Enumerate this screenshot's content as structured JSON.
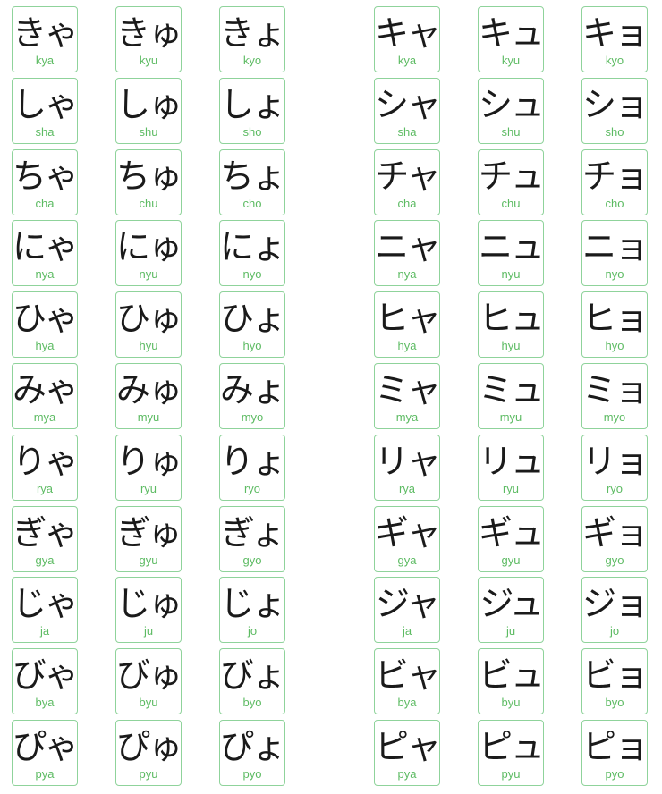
{
  "colors": {
    "border": "#8fd39b",
    "romaji": "#5dbb63",
    "kana": "#1a1a1a"
  },
  "hiragana": [
    [
      {
        "kana": "きゃ",
        "romaji": "kya"
      },
      {
        "kana": "きゅ",
        "romaji": "kyu"
      },
      {
        "kana": "きょ",
        "romaji": "kyo"
      }
    ],
    [
      {
        "kana": "しゃ",
        "romaji": "sha"
      },
      {
        "kana": "しゅ",
        "romaji": "shu"
      },
      {
        "kana": "しょ",
        "romaji": "sho"
      }
    ],
    [
      {
        "kana": "ちゃ",
        "romaji": "cha"
      },
      {
        "kana": "ちゅ",
        "romaji": "chu"
      },
      {
        "kana": "ちょ",
        "romaji": "cho"
      }
    ],
    [
      {
        "kana": "にゃ",
        "romaji": "nya"
      },
      {
        "kana": "にゅ",
        "romaji": "nyu"
      },
      {
        "kana": "にょ",
        "romaji": "nyo"
      }
    ],
    [
      {
        "kana": "ひゃ",
        "romaji": "hya"
      },
      {
        "kana": "ひゅ",
        "romaji": "hyu"
      },
      {
        "kana": "ひょ",
        "romaji": "hyo"
      }
    ],
    [
      {
        "kana": "みゃ",
        "romaji": "mya"
      },
      {
        "kana": "みゅ",
        "romaji": "myu"
      },
      {
        "kana": "みょ",
        "romaji": "myo"
      }
    ],
    [
      {
        "kana": "りゃ",
        "romaji": "rya"
      },
      {
        "kana": "りゅ",
        "romaji": "ryu"
      },
      {
        "kana": "りょ",
        "romaji": "ryo"
      }
    ],
    [
      {
        "kana": "ぎゃ",
        "romaji": "gya"
      },
      {
        "kana": "ぎゅ",
        "romaji": "gyu"
      },
      {
        "kana": "ぎょ",
        "romaji": "gyo"
      }
    ],
    [
      {
        "kana": "じゃ",
        "romaji": "ja"
      },
      {
        "kana": "じゅ",
        "romaji": "ju"
      },
      {
        "kana": "じょ",
        "romaji": "jo"
      }
    ],
    [
      {
        "kana": "びゃ",
        "romaji": "bya"
      },
      {
        "kana": "びゅ",
        "romaji": "byu"
      },
      {
        "kana": "びょ",
        "romaji": "byo"
      }
    ],
    [
      {
        "kana": "ぴゃ",
        "romaji": "pya"
      },
      {
        "kana": "ぴゅ",
        "romaji": "pyu"
      },
      {
        "kana": "ぴょ",
        "romaji": "pyo"
      }
    ]
  ],
  "katakana": [
    [
      {
        "kana": "キャ",
        "romaji": "kya"
      },
      {
        "kana": "キュ",
        "romaji": "kyu"
      },
      {
        "kana": "キョ",
        "romaji": "kyo"
      }
    ],
    [
      {
        "kana": "シャ",
        "romaji": "sha"
      },
      {
        "kana": "シュ",
        "romaji": "shu"
      },
      {
        "kana": "ショ",
        "romaji": "sho"
      }
    ],
    [
      {
        "kana": "チャ",
        "romaji": "cha"
      },
      {
        "kana": "チュ",
        "romaji": "chu"
      },
      {
        "kana": "チョ",
        "romaji": "cho"
      }
    ],
    [
      {
        "kana": "ニャ",
        "romaji": "nya"
      },
      {
        "kana": "ニュ",
        "romaji": "nyu"
      },
      {
        "kana": "ニョ",
        "romaji": "nyo"
      }
    ],
    [
      {
        "kana": "ヒャ",
        "romaji": "hya"
      },
      {
        "kana": "ヒュ",
        "romaji": "hyu"
      },
      {
        "kana": "ヒョ",
        "romaji": "hyo"
      }
    ],
    [
      {
        "kana": "ミャ",
        "romaji": "mya"
      },
      {
        "kana": "ミュ",
        "romaji": "myu"
      },
      {
        "kana": "ミョ",
        "romaji": "myo"
      }
    ],
    [
      {
        "kana": "リャ",
        "romaji": "rya"
      },
      {
        "kana": "リュ",
        "romaji": "ryu"
      },
      {
        "kana": "リョ",
        "romaji": "ryo"
      }
    ],
    [
      {
        "kana": "ギャ",
        "romaji": "gya"
      },
      {
        "kana": "ギュ",
        "romaji": "gyu"
      },
      {
        "kana": "ギョ",
        "romaji": "gyo"
      }
    ],
    [
      {
        "kana": "ジャ",
        "romaji": "ja"
      },
      {
        "kana": "ジュ",
        "romaji": "ju"
      },
      {
        "kana": "ジョ",
        "romaji": "jo"
      }
    ],
    [
      {
        "kana": "ビャ",
        "romaji": "bya"
      },
      {
        "kana": "ビュ",
        "romaji": "byu"
      },
      {
        "kana": "ビョ",
        "romaji": "byo"
      }
    ],
    [
      {
        "kana": "ピャ",
        "romaji": "pya"
      },
      {
        "kana": "ピュ",
        "romaji": "pyu"
      },
      {
        "kana": "ピョ",
        "romaji": "pyo"
      }
    ]
  ]
}
